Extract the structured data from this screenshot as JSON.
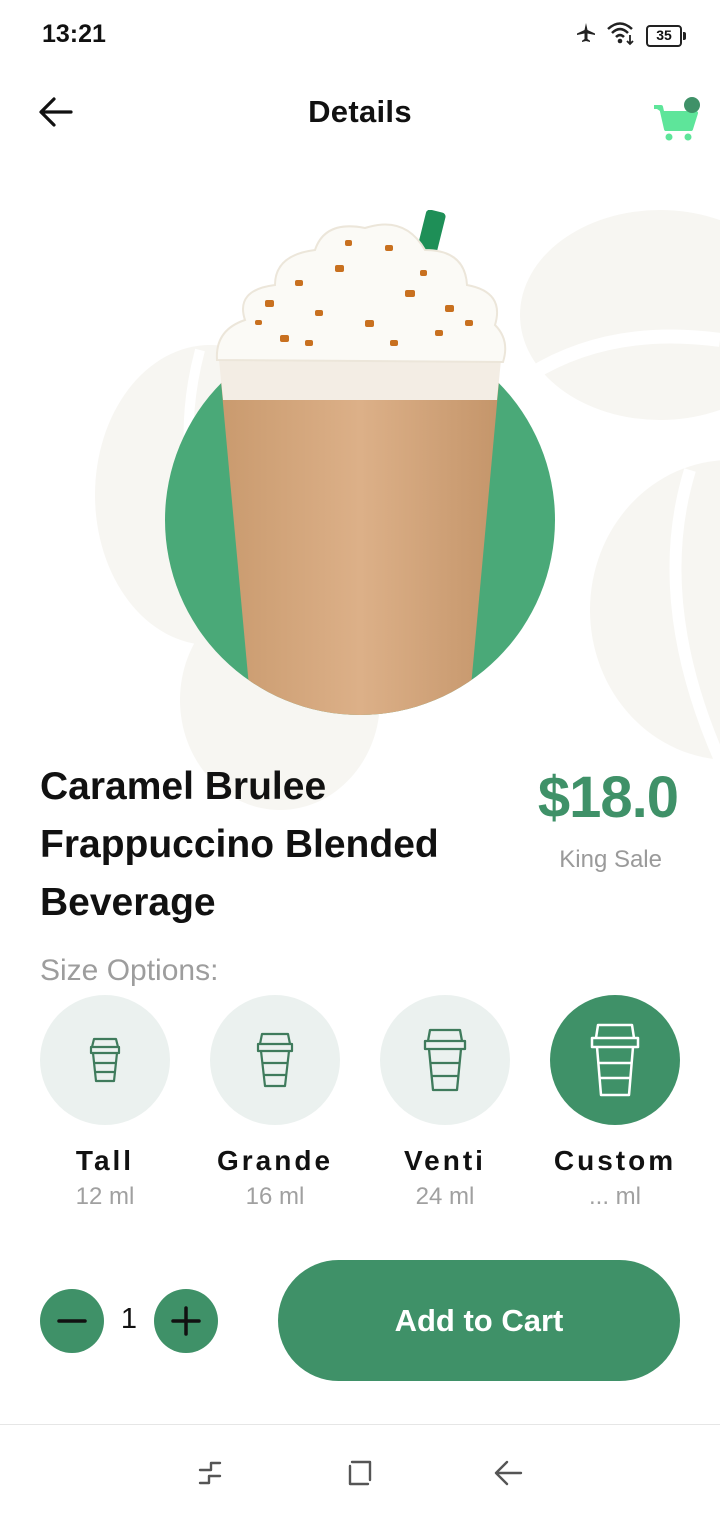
{
  "status_bar": {
    "time": "13:21",
    "battery": "35",
    "icons": [
      "airplane-icon",
      "wifi-icon",
      "battery-icon"
    ]
  },
  "app_bar": {
    "title": "Details",
    "back_icon": "arrow-left-icon",
    "cart_icon": "shopping-cart-icon"
  },
  "product": {
    "name": "Caramel Brulee Frappuccino Blended Beverage",
    "price": "$18.0",
    "sale_label": "King Sale"
  },
  "sizes": {
    "heading": "Size Options:",
    "options": [
      {
        "name": "Tall",
        "volume": "12 ml",
        "selected": false
      },
      {
        "name": "Grande",
        "volume": "16 ml",
        "selected": false
      },
      {
        "name": "Venti",
        "volume": "24 ml",
        "selected": false
      },
      {
        "name": "Custom",
        "volume": "... ml",
        "selected": true
      }
    ]
  },
  "quantity": {
    "value": "1"
  },
  "actions": {
    "add_to_cart": "Add to Cart"
  },
  "colors": {
    "accent": "#3f9168",
    "circle_green": "#4aa978",
    "chip_bg": "#ebf1ef",
    "bean": "#f7f6f2",
    "cart_icon": "#5ee59a"
  }
}
